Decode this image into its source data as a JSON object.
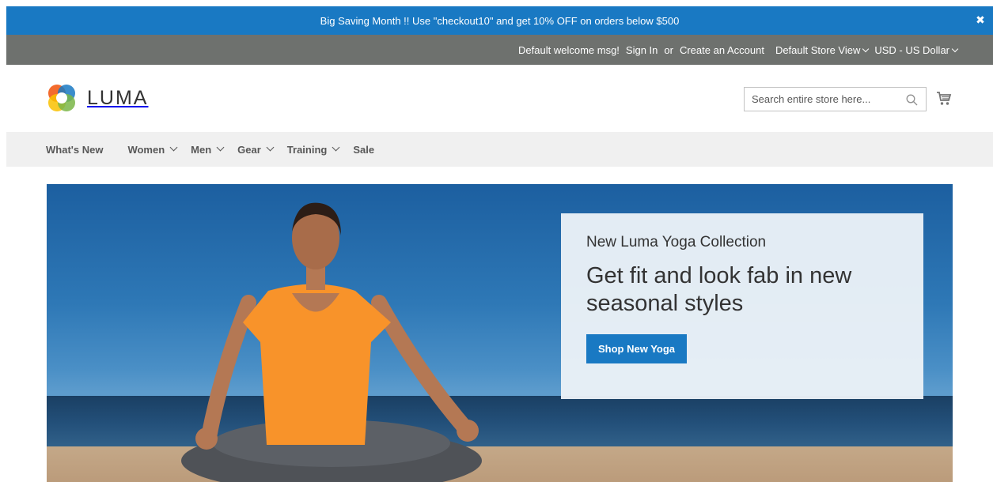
{
  "promo_bar": {
    "text": "Big Saving Month !! Use \"checkout10\" and get 10% OFF on orders below $500",
    "close_icon": "close-icon",
    "color": "#1979c3"
  },
  "top_links": {
    "welcome": "Default welcome msg!",
    "sign_in": "Sign In",
    "or": "or",
    "create_account": "Create an Account",
    "store_view": "Default Store View",
    "currency": "USD - US Dollar"
  },
  "header": {
    "logo_text": "LUMA",
    "search_placeholder": "Search entire store here...",
    "search_icon": "search-icon",
    "cart_icon": "cart-icon"
  },
  "nav": {
    "items": [
      {
        "label": "What's New",
        "has_dropdown": false
      },
      {
        "label": "Women",
        "has_dropdown": true
      },
      {
        "label": "Men",
        "has_dropdown": true
      },
      {
        "label": "Gear",
        "has_dropdown": true
      },
      {
        "label": "Training",
        "has_dropdown": true
      },
      {
        "label": "Sale",
        "has_dropdown": false
      }
    ]
  },
  "hero": {
    "subtitle": "New Luma Yoga Collection",
    "title": "Get fit and look fab in new seasonal styles",
    "button_label": "Shop New Yoga",
    "button_color": "#1979c3"
  }
}
